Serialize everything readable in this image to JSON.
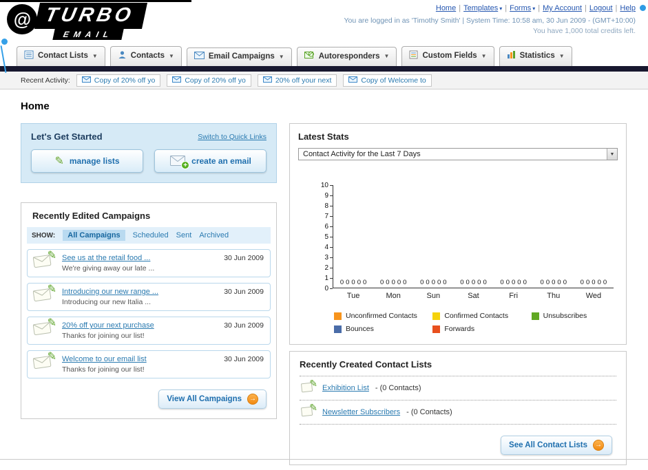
{
  "header": {
    "logo_line1": "TURBO",
    "logo_line2": "EMAIL",
    "logo_swirl": "@",
    "links": [
      "Home",
      "Templates",
      "Forms",
      "My Account",
      "Logout",
      "Help"
    ],
    "login_info": "You are logged in as 'Timothy Smith' | System Time: 10:58 am, 30 Jun 2009 - (GMT+10:00)",
    "credits": "You have 1,000 total credits left."
  },
  "nav_tabs": [
    {
      "label": "Contact Lists"
    },
    {
      "label": "Contacts"
    },
    {
      "label": "Email Campaigns"
    },
    {
      "label": "Autoresponders"
    },
    {
      "label": "Custom Fields"
    },
    {
      "label": "Statistics"
    }
  ],
  "recent_activity": {
    "label": "Recent Activity:",
    "items": [
      "Copy of 20% off yo",
      "Copy of 20% off yo",
      "20% off your next",
      "Copy of Welcome to"
    ]
  },
  "page_title": "Home",
  "get_started": {
    "title": "Let's Get Started",
    "switch_link": "Switch to Quick Links",
    "manage_lists": "manage lists",
    "create_email": "create an email"
  },
  "campaigns": {
    "title": "Recently Edited Campaigns",
    "show_label": "SHOW:",
    "filters": [
      "All Campaigns",
      "Scheduled",
      "Sent",
      "Archived"
    ],
    "items": [
      {
        "title": "See us at the retail food ...",
        "subtitle": "We're giving away our late ...",
        "date": "30 Jun 2009"
      },
      {
        "title": "Introducing our new range ...",
        "subtitle": "Introducing our new Italia ...",
        "date": "30 Jun 2009"
      },
      {
        "title": "20% off your next purchase",
        "subtitle": "Thanks for joining our list!",
        "date": "30 Jun 2009"
      },
      {
        "title": "Welcome to our email list",
        "subtitle": "Thanks for joining our list!",
        "date": "30 Jun 2009"
      }
    ],
    "view_all_label": "View All Campaigns"
  },
  "stats": {
    "title": "Latest Stats",
    "dropdown_value": "Contact Activity for the Last 7 Days",
    "chart_data": {
      "type": "bar",
      "title": "Contact Activity for the Last 7 Days",
      "categories": [
        "Tue",
        "Mon",
        "Sun",
        "Sat",
        "Fri",
        "Thu",
        "Wed"
      ],
      "series": [
        {
          "name": "Unconfirmed Contacts",
          "color": "#f7941d",
          "values": [
            0,
            0,
            0,
            0,
            0,
            0,
            0
          ]
        },
        {
          "name": "Confirmed Contacts",
          "color": "#f5d20c",
          "values": [
            0,
            0,
            0,
            0,
            0,
            0,
            0
          ]
        },
        {
          "name": "Unsubscribes",
          "color": "#61a823",
          "values": [
            0,
            0,
            0,
            0,
            0,
            0,
            0
          ]
        },
        {
          "name": "Bounces",
          "color": "#4a6ca8",
          "values": [
            0,
            0,
            0,
            0,
            0,
            0,
            0
          ]
        },
        {
          "name": "Forwards",
          "color": "#e8501e",
          "values": [
            0,
            0,
            0,
            0,
            0,
            0,
            0
          ]
        }
      ],
      "ylim": [
        0,
        10
      ],
      "xlabel": "",
      "ylabel": "",
      "grid": false,
      "legend_position": "bottom",
      "value_labels_shown": true
    }
  },
  "contact_lists": {
    "title": "Recently Created Contact Lists",
    "items": [
      {
        "name": "Exhibition List",
        "count": "- (0 Contacts)"
      },
      {
        "name": "Newsletter Subscribers",
        "count": "- (0 Contacts)"
      }
    ],
    "see_all_label": "See All Contact Lists"
  }
}
